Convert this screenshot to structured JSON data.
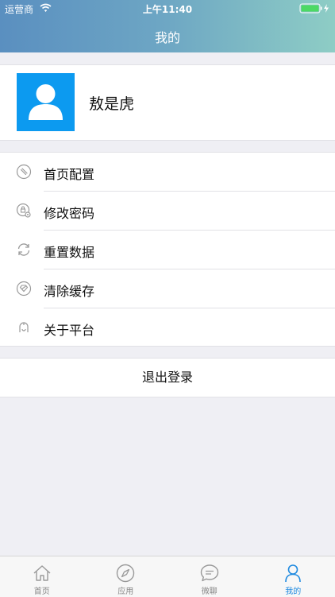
{
  "status_bar": {
    "carrier": "运营商",
    "time": "上午11:40"
  },
  "nav": {
    "title": "我的"
  },
  "profile": {
    "name": "敖是虎"
  },
  "menu": {
    "items": [
      {
        "label": "首页配置",
        "icon": "link-icon"
      },
      {
        "label": "修改密码",
        "icon": "lock-settings-icon"
      },
      {
        "label": "重置数据",
        "icon": "refresh-icon"
      },
      {
        "label": "清除缓存",
        "icon": "clear-cache-icon"
      },
      {
        "label": "关于平台",
        "icon": "info-person-icon"
      }
    ]
  },
  "logout": {
    "label": "退出登录"
  },
  "tabbar": {
    "tabs": [
      {
        "label": "首页",
        "icon": "home-icon"
      },
      {
        "label": "应用",
        "icon": "compass-icon"
      },
      {
        "label": "微聊",
        "icon": "chat-icon"
      },
      {
        "label": "我的",
        "icon": "person-icon"
      }
    ],
    "active_index": 3
  },
  "colors": {
    "accent": "#1f8ae0",
    "avatar_bg": "#0c9af0",
    "icon_gray": "#999999"
  }
}
